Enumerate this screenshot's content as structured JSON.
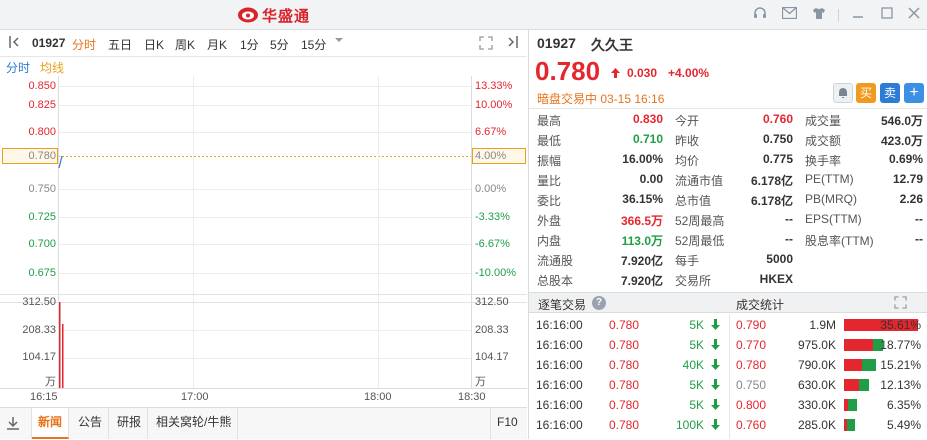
{
  "app": {
    "name": "华盛通"
  },
  "toolbar": {
    "code": "01927",
    "periods": [
      "分时",
      "五日",
      "日K",
      "周K",
      "月K",
      "1分",
      "5分",
      "15分"
    ],
    "active_period": "分时"
  },
  "chart": {
    "subtabs": [
      "分时",
      "均线"
    ],
    "left_prices": [
      "0.850",
      "0.825",
      "0.800",
      "0.780",
      "0.750",
      "0.725",
      "0.700",
      "0.675"
    ],
    "right_pcts": [
      "13.33%",
      "10.00%",
      "6.67%",
      "4.00%",
      "0.00%",
      "-3.33%",
      "-6.67%",
      "-10.00%"
    ],
    "vol_left": [
      "312.50",
      "208.33",
      "104.17",
      "万"
    ],
    "vol_right": [
      "312.50",
      "208.33",
      "104.17",
      "万"
    ],
    "x_labels": [
      "16:15",
      "17:00",
      "18:00",
      "18:30"
    ]
  },
  "bottom_tabs": [
    "新闻",
    "公告",
    "研报",
    "相关窝轮/牛熊",
    "F10"
  ],
  "quote": {
    "code": "01927",
    "name": "久久王",
    "price": "0.780",
    "change": "0.030",
    "change_pct": "+4.00%",
    "status": "暗盘交易中 03-15 16:16",
    "buy_label": "买",
    "sell_label": "卖",
    "add_label": "+",
    "stats": [
      [
        "最高",
        "0.830",
        "今开",
        "0.760",
        "成交量",
        "546.0万"
      ],
      [
        "最低",
        "0.710",
        "昨收",
        "0.750",
        "成交额",
        "423.0万"
      ],
      [
        "振幅",
        "16.00%",
        "均价",
        "0.775",
        "换手率",
        "0.69%"
      ],
      [
        "量比",
        "0.00",
        "流通市值",
        "6.178亿",
        "PE(TTM)",
        "12.79"
      ],
      [
        "委比",
        "36.15%",
        "总市值",
        "6.178亿",
        "PB(MRQ)",
        "2.26"
      ],
      [
        "外盘",
        "366.5万",
        "52周最高",
        "--",
        "EPS(TTM)",
        "--"
      ],
      [
        "内盘",
        "113.0万",
        "52周最低",
        "--",
        "股息率(TTM)",
        "--"
      ],
      [
        "流通股",
        "7.920亿",
        "每手",
        "5000",
        "",
        ""
      ],
      [
        "总股本",
        "7.920亿",
        "交易所",
        "HKEX",
        "",
        ""
      ]
    ]
  },
  "ticks_header": "逐笔交易",
  "stats_header": "成交统计",
  "ticks": [
    {
      "time": "16:16:00",
      "price": "0.780",
      "vol": "5K"
    },
    {
      "time": "16:16:00",
      "price": "0.780",
      "vol": "5K"
    },
    {
      "time": "16:16:00",
      "price": "0.780",
      "vol": "40K"
    },
    {
      "time": "16:16:00",
      "price": "0.780",
      "vol": "5K"
    },
    {
      "time": "16:16:00",
      "price": "0.780",
      "vol": "5K"
    },
    {
      "time": "16:16:00",
      "price": "0.780",
      "vol": "100K"
    }
  ],
  "deal_stats": [
    {
      "price": "0.790",
      "vol": "1.9M",
      "pct": "35.61%",
      "share": 0.3561,
      "buy": 1.0
    },
    {
      "price": "0.770",
      "vol": "975.0K",
      "pct": "18.77%",
      "share": 0.1877,
      "buy": 0.75
    },
    {
      "price": "0.780",
      "vol": "790.0K",
      "pct": "15.21%",
      "share": 0.1521,
      "buy": 0.55
    },
    {
      "price": "0.750",
      "vol": "630.0K",
      "pct": "12.13%",
      "share": 0.1213,
      "buy": 0.6
    },
    {
      "price": "0.800",
      "vol": "330.0K",
      "pct": "6.35%",
      "share": 0.0635,
      "buy": 0.3
    },
    {
      "price": "0.760",
      "vol": "285.0K",
      "pct": "5.49%",
      "share": 0.0549,
      "buy": 0.3
    }
  ],
  "colors": {
    "up": "#e4262e",
    "down": "#1f9e47",
    "accent": "#e8731a",
    "blue": "#2e7bd6"
  }
}
